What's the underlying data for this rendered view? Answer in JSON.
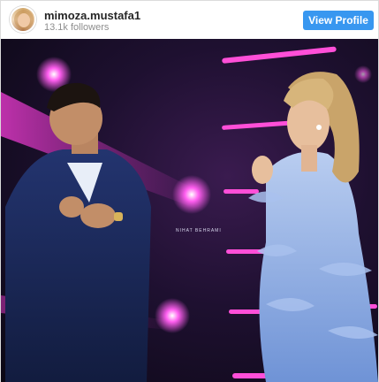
{
  "header": {
    "username": "mimoza.mustafa1",
    "followers": "13.1k followers",
    "view_profile_label": "View Profile"
  },
  "photo": {
    "watermark": "NIHAT BEHRAMI"
  },
  "colors": {
    "button": "#3897f0",
    "username": "#262626",
    "followers": "#8e8e8e"
  }
}
